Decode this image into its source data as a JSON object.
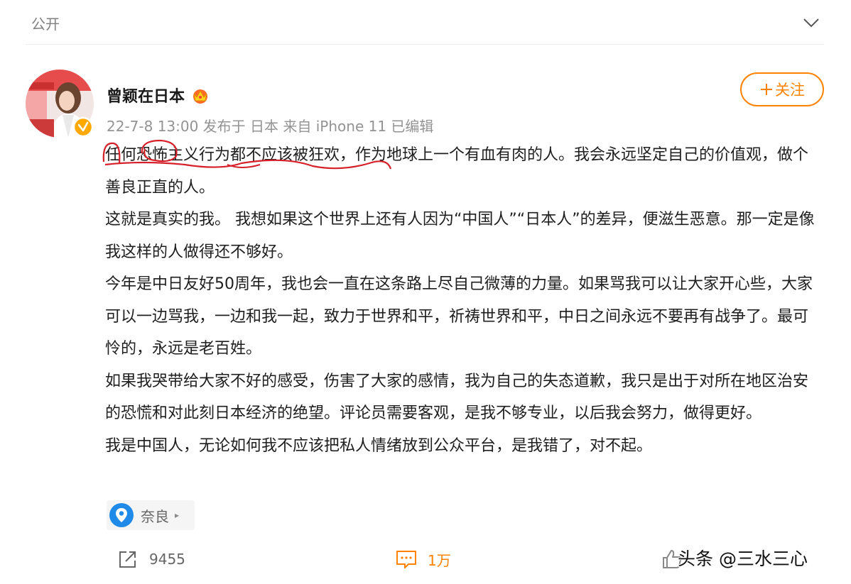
{
  "header": {
    "visibility": "公开",
    "expand_icon": "chevron-down-icon"
  },
  "post": {
    "author": "曾颖在日本",
    "member_icon": "crown-icon",
    "verified_icon": "verified-badge-icon",
    "meta": "22-7-8 13:00 发布于 日本 来自 iPhone 11 已编辑",
    "follow_label": "关注",
    "paragraphs": [
      "任何恐怖主义行为都不应该被狂欢，作为地球上一个有血有肉的人。我会永远坚定自己的价值观，做个善良正直的人。",
      "这就是真实的我。 我想如果这个世界上还有人因为“中国人”“日本人”的差异，便滋生恶意。那一定是像我这样的人做得还不够好。",
      "今年是中日友好50周年，我也会一直在这条路上尽自己微薄的力量。如果骂我可以让大家开心些，大家可以一边骂我，一边和我一起，致力于世界和平，祈祷世界和平，中日之间永远不要再有战争了。最可怜的，永远是老百姓。",
      "如果我哭带给大家不好的感受，伤害了大家的感情，我为自己的失态道歉，我只是出于对所在地区治安的恐慌和对此刻日本经济的绝望。评论员需要客观，是我不够专业，以后我会努力，做得更好。",
      "我是中国人，无论如何我不应该把私人情绪放到公众平台，是我错了，对不起。"
    ],
    "location": "奈良"
  },
  "actions": {
    "share_count": "9455",
    "comment_count": "1万"
  },
  "watermark": "头条 @三水三心",
  "colors": {
    "accent": "#ff8200",
    "location_pin": "#1f8ae8",
    "annotation": "#d6202a"
  }
}
